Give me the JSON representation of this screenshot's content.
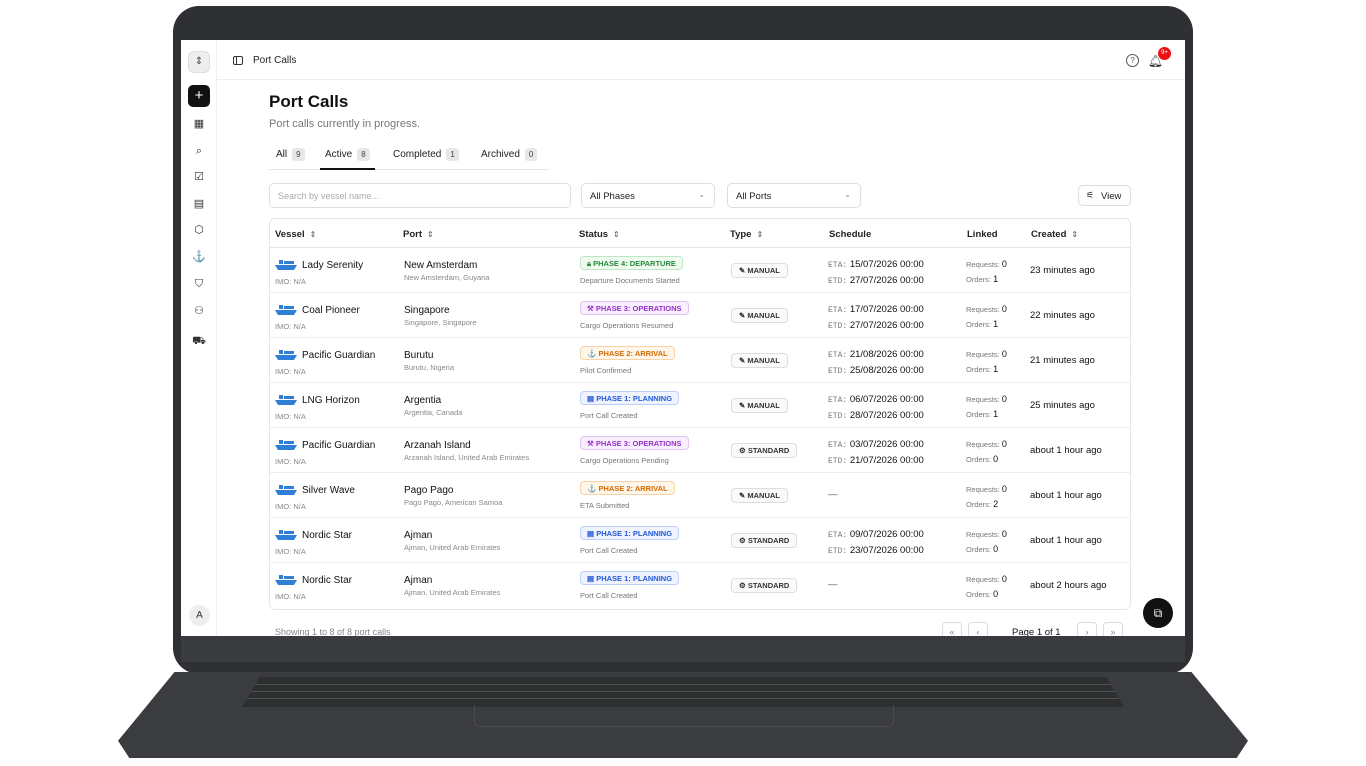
{
  "topbar": {
    "breadcrumb": "Port Calls",
    "help_glyph": "?",
    "notification_badge": "9+"
  },
  "rail": {
    "avatar_letter": "A"
  },
  "page": {
    "title": "Port Calls",
    "subtitle": "Port calls currently in progress."
  },
  "tabs": [
    {
      "label": "All",
      "count": "9"
    },
    {
      "label": "Active",
      "count": "8"
    },
    {
      "label": "Completed",
      "count": "1"
    },
    {
      "label": "Archived",
      "count": "0"
    }
  ],
  "filters": {
    "search_placeholder": "Search by vessel name...",
    "phases": "All Phases",
    "ports": "All Ports",
    "view_label": "View"
  },
  "columns": {
    "vessel": "Vessel",
    "port": "Port",
    "status": "Status",
    "type": "Type",
    "schedule": "Schedule",
    "linked": "Linked",
    "created": "Created"
  },
  "labels": {
    "eta": "ETA:",
    "etd": "ETD:",
    "requests": "Requests:",
    "orders": "Orders:",
    "imo": "IMO: N/A"
  },
  "rows": [
    {
      "vessel": "Lady Serenity",
      "port": "New Amsterdam",
      "port_sub": "New Amsterdam, Guyana",
      "phase": "PHASE 4: DEPARTURE",
      "phase_class": "p4",
      "phase_icon": "lock-icon",
      "status_text": "Departure Documents Started",
      "type": "MANUAL",
      "eta": "15/07/2026 00:00",
      "etd": "27/07/2026 00:00",
      "requests": "0",
      "orders": "1",
      "created": "23 minutes ago"
    },
    {
      "vessel": "Coal Pioneer",
      "port": "Singapore",
      "port_sub": "Singapore, Singapore",
      "phase": "PHASE 3: OPERATIONS",
      "phase_class": "p3",
      "phase_icon": "wrench-icon",
      "status_text": "Cargo Operations Resumed",
      "type": "MANUAL",
      "eta": "17/07/2026 00:00",
      "etd": "27/07/2026 00:00",
      "requests": "0",
      "orders": "1",
      "created": "22 minutes ago"
    },
    {
      "vessel": "Pacific Guardian",
      "port": "Burutu",
      "port_sub": "Burutu, Nigeria",
      "phase": "PHASE 2: ARRIVAL",
      "phase_class": "p2",
      "phase_icon": "anchor-icon",
      "status_text": "Pilot Confirmed",
      "type": "MANUAL",
      "eta": "21/08/2026 00:00",
      "etd": "25/08/2026 00:00",
      "requests": "0",
      "orders": "1",
      "created": "21 minutes ago"
    },
    {
      "vessel": "LNG Horizon",
      "port": "Argentia",
      "port_sub": "Argentia, Canada",
      "phase": "PHASE 1: PLANNING",
      "phase_class": "p1",
      "phase_icon": "clipboard-icon",
      "status_text": "Port Call Created",
      "type": "MANUAL",
      "eta": "06/07/2026 00:00",
      "etd": "28/07/2026 00:00",
      "requests": "0",
      "orders": "1",
      "created": "25 minutes ago"
    },
    {
      "vessel": "Pacific Guardian",
      "port": "Arzanah Island",
      "port_sub": "Arzanah Island, United Arab Emirates",
      "phase": "PHASE 3: OPERATIONS",
      "phase_class": "p3",
      "phase_icon": "wrench-icon",
      "status_text": "Cargo Operations Pending",
      "type": "STANDARD",
      "eta": "03/07/2026 00:00",
      "etd": "21/07/2026 00:00",
      "requests": "0",
      "orders": "0",
      "created": "about 1 hour ago"
    },
    {
      "vessel": "Silver Wave",
      "port": "Pago Pago",
      "port_sub": "Pago Pago, American Samoa",
      "phase": "PHASE 2: ARRIVAL",
      "phase_class": "p2",
      "phase_icon": "anchor-icon",
      "status_text": "ETA Submitted",
      "type": "MANUAL",
      "eta": "",
      "etd": "",
      "requests": "0",
      "orders": "2",
      "created": "about 1 hour ago"
    },
    {
      "vessel": "Nordic Star",
      "port": "Ajman",
      "port_sub": "Ajman, United Arab Emirates",
      "phase": "PHASE 1: PLANNING",
      "phase_class": "p1",
      "phase_icon": "clipboard-icon",
      "status_text": "Port Call Created",
      "type": "STANDARD",
      "eta": "09/07/2026 00:00",
      "etd": "23/07/2026 00:00",
      "requests": "0",
      "orders": "0",
      "created": "about 1 hour ago"
    },
    {
      "vessel": "Nordic Star",
      "port": "Ajman",
      "port_sub": "Ajman, United Arab Emirates",
      "phase": "PHASE 1: PLANNING",
      "phase_class": "p1",
      "phase_icon": "clipboard-icon",
      "status_text": "Port Call Created",
      "type": "STANDARD",
      "eta": "",
      "etd": "",
      "requests": "0",
      "orders": "0",
      "created": "about 2 hours ago"
    }
  ],
  "empty_schedule": "—",
  "footer": {
    "showing": "Showing 1 to 8 of 8 port calls",
    "page_label": "Page 1 of 1"
  },
  "colors": {
    "accent": "#111111",
    "ship_blue": "#2f7fd6",
    "badge_red": "#e11111"
  }
}
